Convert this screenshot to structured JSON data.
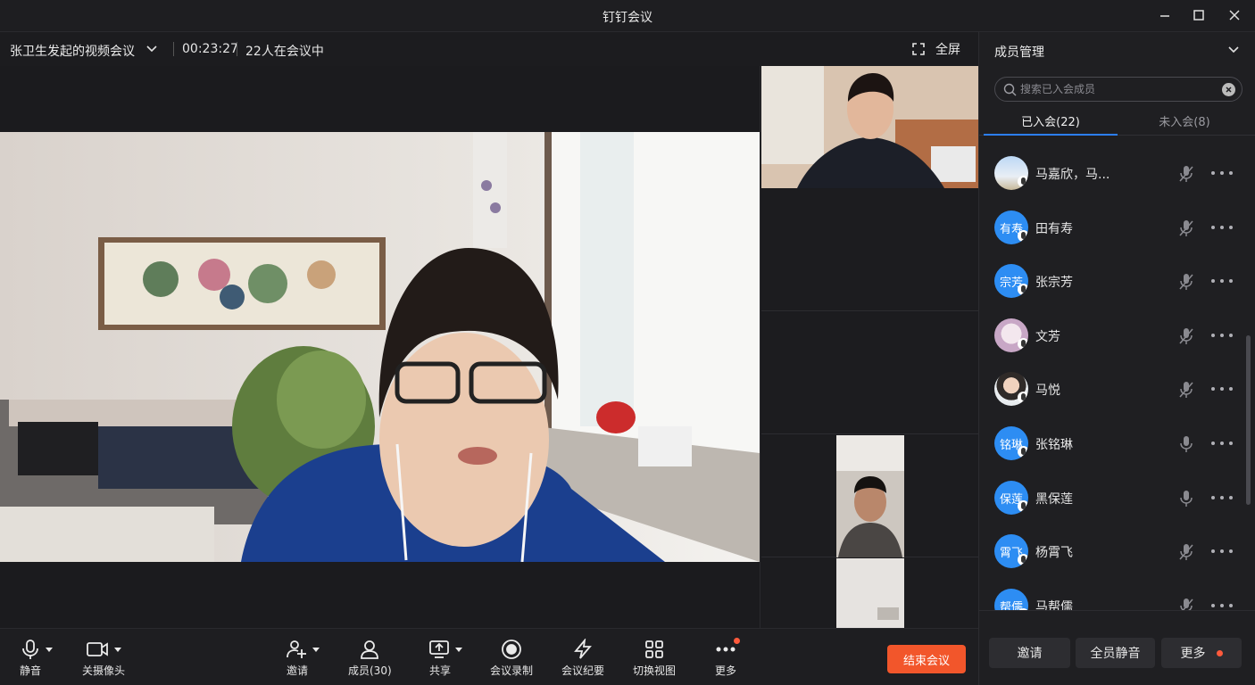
{
  "window": {
    "title": "钉钉会议"
  },
  "meeting": {
    "title": "张卫生发起的视频会议",
    "elapsed": "00:23:27",
    "participants_text": "22人在会议中",
    "fullscreen_label": "全屏"
  },
  "panel": {
    "header": "成员管理",
    "search_placeholder": "搜索已入会成员",
    "tabs": [
      {
        "label": "已入会(22)",
        "active": true
      },
      {
        "label": "未入会(8)",
        "active": false
      }
    ],
    "members": [
      {
        "name": "马嘉欣，马...",
        "avatar_text": "",
        "avatar_kind": "photo-sky",
        "mic": "muted"
      },
      {
        "name": "田有寿",
        "avatar_text": "有寿",
        "avatar_kind": "text",
        "mic": "muted"
      },
      {
        "name": "张宗芳",
        "avatar_text": "宗芳",
        "avatar_kind": "text",
        "mic": "muted"
      },
      {
        "name": "文芳",
        "avatar_text": "",
        "avatar_kind": "photo-anime",
        "mic": "muted"
      },
      {
        "name": "马悦",
        "avatar_text": "",
        "avatar_kind": "photo-person",
        "mic": "muted"
      },
      {
        "name": "张铭琳",
        "avatar_text": "铭琳",
        "avatar_kind": "text",
        "mic": "on"
      },
      {
        "name": "黑保莲",
        "avatar_text": "保莲",
        "avatar_kind": "text",
        "mic": "on"
      },
      {
        "name": "杨霄飞",
        "avatar_text": "霄飞",
        "avatar_kind": "text",
        "mic": "muted"
      },
      {
        "name": "马帮儒",
        "avatar_text": "帮儒",
        "avatar_kind": "text",
        "mic": "muted"
      }
    ],
    "footer": {
      "invite": "邀请",
      "mute_all": "全员静音",
      "more": "更多"
    }
  },
  "toolbar": {
    "mute": "静音",
    "camera": "关摄像头",
    "invite": "邀请",
    "members": "成员(30)",
    "share": "共享",
    "record": "会议录制",
    "minutes": "会议纪要",
    "switch_view": "切换视图",
    "more": "更多",
    "end": "结束会议"
  },
  "colors": {
    "accent": "#2c7ef8",
    "avatar_blue": "#2d8df3",
    "end_button": "#f2562b",
    "notify_dot": "#ff5a3c"
  },
  "icons": [
    "minimize-icon",
    "maximize-icon",
    "close-icon",
    "chevron-down-icon",
    "fullscreen-icon",
    "search-icon",
    "clear-icon",
    "microphone-icon",
    "microphone-muted-icon",
    "more-dots-icon",
    "camera-icon",
    "invite-icon",
    "members-icon",
    "share-icon",
    "record-icon",
    "minutes-icon",
    "grid-view-icon"
  ]
}
